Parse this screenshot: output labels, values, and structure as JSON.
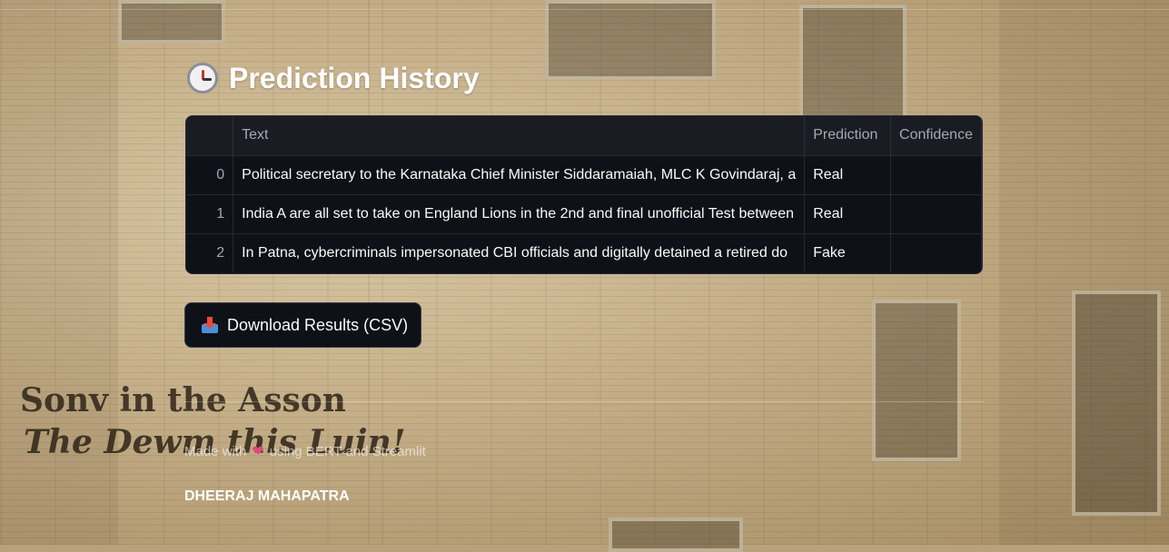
{
  "section": {
    "title": "Prediction History",
    "icon": "clock-icon"
  },
  "table": {
    "columns": [
      "",
      "Text",
      "Prediction",
      "Confidence"
    ],
    "rows": [
      {
        "index": "0",
        "text": "Political secretary to the Karnataka Chief Minister Siddaramaiah, MLC K Govindaraj, a",
        "prediction": "Real",
        "confidence": ""
      },
      {
        "index": "1",
        "text": "India A are all set to take on England Lions in the 2nd and final unofficial Test between",
        "prediction": "Real",
        "confidence": ""
      },
      {
        "index": "2",
        "text": "In Patna, cybercriminals impersonated CBI officials and digitally detained a retired do",
        "prediction": "Fake",
        "confidence": ""
      }
    ]
  },
  "download": {
    "label": "Download Results (CSV)",
    "icon": "inbox-tray-icon"
  },
  "footer": {
    "made_with": "Made with",
    "heart_icon": "heart-icon",
    "using": "using BERT and Streamlit",
    "author": "DHEERAJ MAHAPATRA"
  },
  "background_headline": {
    "line1": "Sonv in the Asson",
    "line2": "The Dewm this Luin!"
  },
  "colors": {
    "panel": "#0e1117",
    "header": "#1a1c23",
    "text": "#fafafa",
    "muted": "#a3a8b4"
  }
}
